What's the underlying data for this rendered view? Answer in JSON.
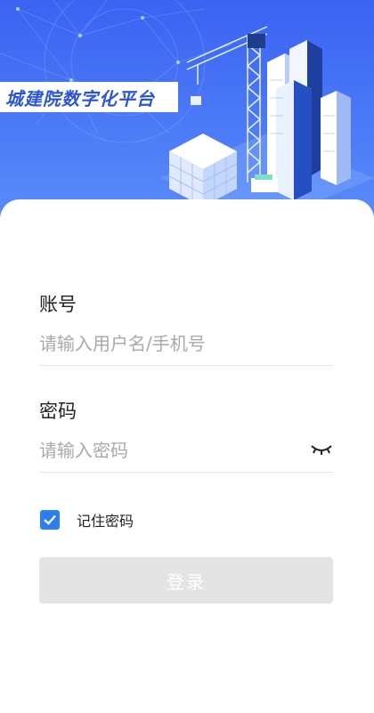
{
  "app": {
    "title": "城建院数字化平台"
  },
  "login": {
    "account_label": "账号",
    "account_placeholder": "请输入用户名/手机号",
    "password_label": "密码",
    "password_placeholder": "请输入密码",
    "remember_label": "记住密码",
    "remember_checked": true,
    "login_button": "登录"
  },
  "colors": {
    "hero_gradient_top": "#3a63f2",
    "hero_gradient_bottom": "#5b8df8",
    "title_text": "#2a55d6",
    "checkbox": "#2c7df0",
    "button_disabled": "#e4e4e4"
  },
  "icons": {
    "password_toggle": "eye-closed-icon",
    "checkbox": "checkmark-icon"
  }
}
